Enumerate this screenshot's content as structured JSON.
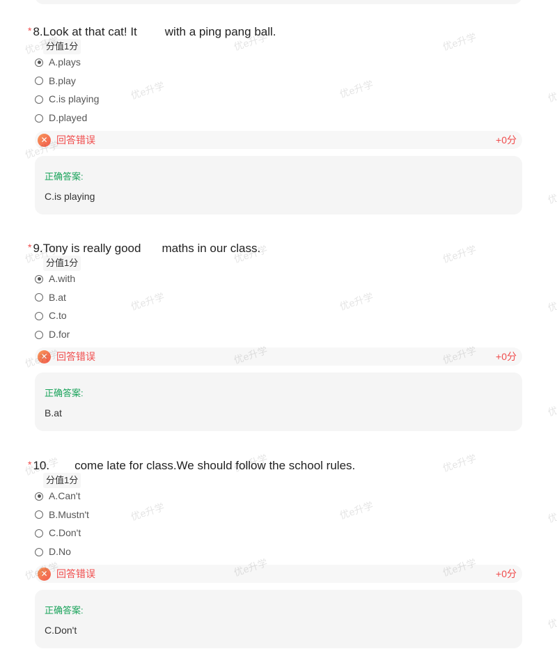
{
  "questions": [
    {
      "number": "8.",
      "text_before": "Look at that cat! It",
      "text_after": "with a ping pang ball.",
      "score_tag": "分值1分",
      "options": [
        "A.plays",
        "B.play",
        "C.is playing",
        "D.played"
      ],
      "selected_index": 0,
      "result": "回答错误",
      "score_change": "+0分",
      "answer_label": "正确答案:",
      "answer_value": "C.is playing"
    },
    {
      "number": "9.",
      "text_before": "Tony is really good",
      "text_after": "maths in our class.",
      "score_tag": "分值1分",
      "options": [
        "A.with",
        "B.at",
        "C.to",
        "D.for"
      ],
      "selected_index": 0,
      "result": "回答错误",
      "score_change": "+0分",
      "answer_label": "正确答案:",
      "answer_value": "B.at"
    },
    {
      "number": "10.",
      "text_before": "",
      "text_after": "come late for class.We should follow the school rules.",
      "score_tag": "分值1分",
      "options": [
        "A.Can't",
        "B.Mustn't",
        "C.Don't",
        "D.No"
      ],
      "selected_index": 0,
      "result": "回答错误",
      "score_change": "+0分",
      "answer_label": "正确答案:",
      "answer_value": "C.Don't"
    }
  ],
  "watermark_text": "优e升学",
  "colors": {
    "error": "#f04b4b",
    "correct": "#19a35a",
    "card": "#f5f5f5"
  }
}
